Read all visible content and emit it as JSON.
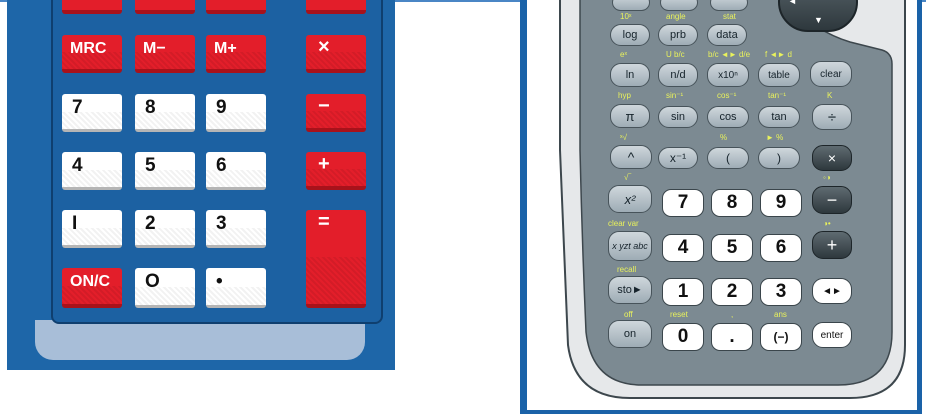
{
  "left_calculator": {
    "keys": {
      "mrc": "MRC",
      "m_minus": "M−",
      "m_plus": "M+",
      "multiply": "×",
      "seven": "7",
      "eight": "8",
      "nine": "9",
      "minus": "−",
      "four": "4",
      "five": "5",
      "six": "6",
      "plus": "+",
      "one": "I",
      "two": "2",
      "three": "3",
      "equals": "=",
      "on_c": "ON/C",
      "zero": "O",
      "decimal": "•"
    }
  },
  "right_calculator": {
    "keys": {
      "ten_power": "10ˣ",
      "angle_label": "angle",
      "stat_label": "stat",
      "log": "log",
      "prb": "prb",
      "data": "data",
      "ex_label": "eˣ",
      "frac_label": "U b/c",
      "frac_dec_label": "b/c ◄► d/e",
      "fd_label": "f ◄► d",
      "ln": "ln",
      "n_over_d": "n/d",
      "x10n": "x10ⁿ",
      "table": "table",
      "clear": "clear",
      "hyp_label": "hyp",
      "sin_inv_label": "sin⁻¹",
      "cos_inv_label": "cos⁻¹",
      "tan_inv_label": "tan⁻¹",
      "k_label": "K",
      "pi": "π",
      "sin": "sin",
      "cos": "cos",
      "tan": "tan",
      "divide": "÷",
      "root_label": "ˣ√",
      "pct_label": "%",
      "to_pct_label": "► %",
      "caret": "^",
      "x_inv": "x⁻¹",
      "lparen": "(",
      "rparen": ")",
      "multiply": "×",
      "sqrt_label": "√‾",
      "contrast_down_label": "◦◑",
      "x_squared": "x²",
      "seven": "7",
      "eight": "8",
      "nine": "9",
      "minus": "−",
      "clear_var_label": "clear var",
      "contrast_up_label": "◑•",
      "xyzt": "x yzt abc",
      "four": "4",
      "five": "5",
      "six": "6",
      "plus": "+",
      "recall_label": "recall",
      "sto": "sto►",
      "one": "1",
      "two": "2",
      "three": "3",
      "toggle": "◄►",
      "off_label": "off",
      "reset_label": "reset",
      "comma_label": ",",
      "ans_label": "ans",
      "on": "on",
      "zero": "0",
      "decimal": ".",
      "negative": "(−)",
      "enter": "enter"
    }
  }
}
